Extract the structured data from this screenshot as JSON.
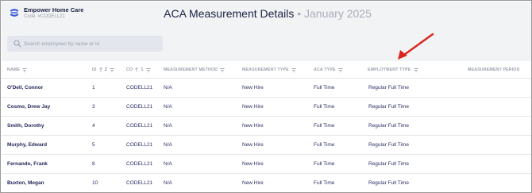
{
  "company": {
    "name": "Empower Home Care",
    "code": "Code: #CODELL21"
  },
  "header": {
    "title": "ACA Measurement Details",
    "separator": "•",
    "period": "January 2025"
  },
  "search": {
    "placeholder": "Search employees by name or id"
  },
  "colors": {
    "accent": "#3b5bdb",
    "annotation_arrow": "#d9261c",
    "header_bg": "#f2f3f5",
    "search_bg": "#e3e6ec"
  },
  "table": {
    "columns": [
      {
        "label": "NAME",
        "sort_order": ""
      },
      {
        "label": "ID",
        "sort_order": "2"
      },
      {
        "label": "CO",
        "sort_order": "1"
      },
      {
        "label": "MEASUREMENT METHOD",
        "sort_order": ""
      },
      {
        "label": "MEASUREMENT TYPE",
        "sort_order": ""
      },
      {
        "label": "ACA TYPE",
        "sort_order": ""
      },
      {
        "label": "EMPLOYMENT TYPE",
        "sort_order": ""
      },
      {
        "label": "MEASUREMENT PERIOD",
        "sort_order": ""
      }
    ],
    "rows": [
      {
        "name": "O'Dell, Connor",
        "id": "1",
        "co": "CODELL21",
        "method": "N/A",
        "mtype": "New Hire",
        "aca": "Full Time",
        "emp": "Regular Full Time",
        "period": ""
      },
      {
        "name": "Cosmo, Drew Jay",
        "id": "3",
        "co": "CODELL21",
        "method": "N/A",
        "mtype": "New Hire",
        "aca": "Full Time",
        "emp": "Regular Full Time",
        "period": ""
      },
      {
        "name": "Smith, Dorothy",
        "id": "4",
        "co": "CODELL21",
        "method": "N/A",
        "mtype": "New Hire",
        "aca": "Full Time",
        "emp": "Regular Full Time",
        "period": ""
      },
      {
        "name": "Murphy, Edward",
        "id": "5",
        "co": "CODELL21",
        "method": "N/A",
        "mtype": "New Hire",
        "aca": "Full Time",
        "emp": "Regular Full Time",
        "period": ""
      },
      {
        "name": "Fernando, Frank",
        "id": "8",
        "co": "CODELL21",
        "method": "N/A",
        "mtype": "New Hire",
        "aca": "Full Time",
        "emp": "Regular Full Time",
        "period": ""
      },
      {
        "name": "Buxton, Megan",
        "id": "10",
        "co": "CODELL21",
        "method": "N/A",
        "mtype": "New Hire",
        "aca": "Full Time",
        "emp": "Regular Full Time",
        "period": ""
      }
    ]
  }
}
